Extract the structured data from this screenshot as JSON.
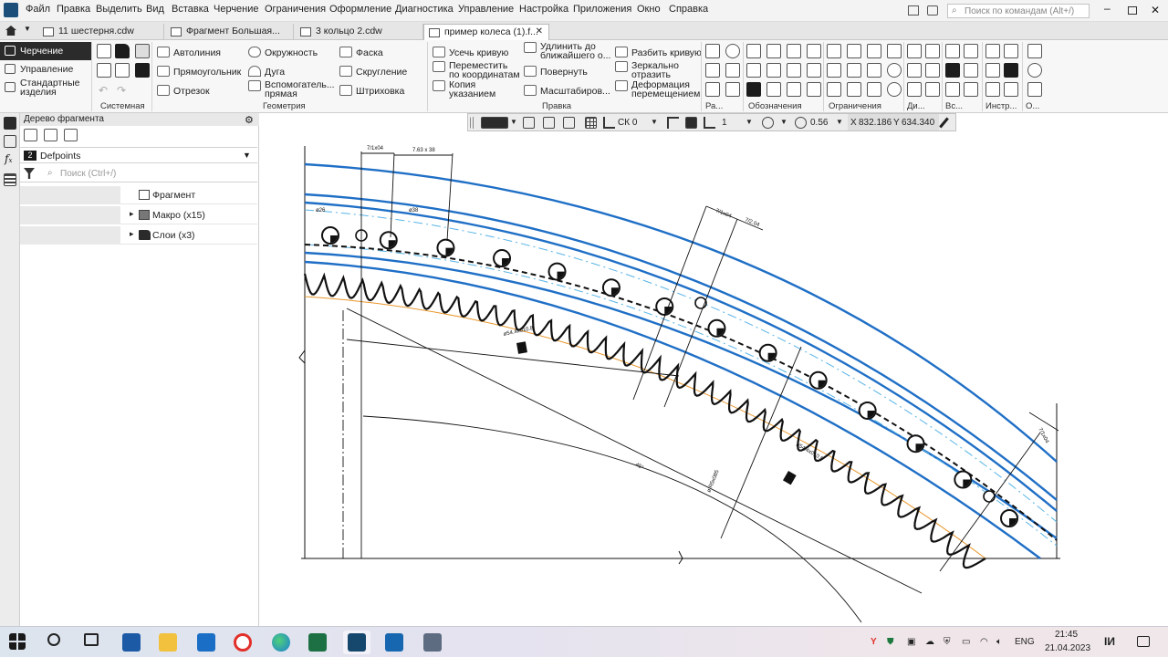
{
  "menubar": {
    "items": [
      "Файл",
      "Правка",
      "Выделить",
      "Вид",
      "Вставка",
      "Черчение",
      "Ограничения",
      "Оформление",
      "Диагностика",
      "Управление",
      "Настройка",
      "Приложения",
      "Окно",
      "Справка"
    ],
    "search_placeholder": "Поиск по командам (Alt+/)"
  },
  "tabs": [
    {
      "label": "11 шестерня.cdw"
    },
    {
      "label": "Фрагмент Большая..."
    },
    {
      "label": "3 кольцо 2.cdw"
    },
    {
      "label": "пример колеса (1).f...",
      "close": "✕"
    }
  ],
  "ribbon": {
    "nav": [
      "Черчение",
      "Управление",
      "Стандартные изделия"
    ],
    "groups": [
      "Системная",
      "Геометрия",
      "Правка",
      "Ра...",
      "Обозначения",
      "Ограничения",
      "Ди...",
      "Вс...",
      "Инстр...",
      "О..."
    ],
    "geometry": [
      [
        "Автолиния",
        "Прямоугольник",
        "Отрезок"
      ],
      [
        "Окружность",
        "Дуга",
        "Вспомогатель... прямая"
      ],
      [
        "Фаска",
        "Скругление",
        "Штриховка"
      ]
    ],
    "edit": [
      [
        "Усечь кривую",
        "Переместить по координатам",
        "Копия указанием"
      ],
      [
        "Удлинить до ближайшего о...",
        "Повернуть",
        "Масштабиров..."
      ],
      [
        "Разбить кривую",
        "Зеркально отразить",
        "Деформация перемещением"
      ]
    ]
  },
  "tree": {
    "title": "Дерево фрагмента",
    "layer_number": "2",
    "layer_name": "Defpoints",
    "search_placeholder": "Поиск (Ctrl+/)",
    "items": [
      {
        "label": "Фрагмент",
        "expander": ""
      },
      {
        "label": "Макро (x15)",
        "expander": "▸"
      },
      {
        "label": "Слои (x3)",
        "expander": "▸"
      }
    ]
  },
  "canvas_toolbar": {
    "cs": "СК 0",
    "step": "1",
    "zoom": "0.56",
    "x_label": "X",
    "x_value": "832.186",
    "y_label": "Y",
    "y_value": "634.340"
  },
  "drawing_labels": {
    "top_dims": [
      "7/1x04",
      "7.63 x 38"
    ],
    "left_dims": [
      "ø26",
      "ø38"
    ],
    "mid_dims": [
      "7/1x04",
      "7/2.04"
    ],
    "radius_labels": [
      "ø54.4x010.8",
      "ø54.4x010.8"
    ],
    "r_label": "ø R5x085",
    "angle": "45°",
    "right_dim": "7/1x04"
  },
  "taskbar": {
    "time": "21:45",
    "date": "21.04.2023",
    "lang": "ENG"
  },
  "colors": {
    "ribbon_active": "#2b2b2b",
    "drawing_blue": "#1f6fc6",
    "drawing_light": "#58b4e6",
    "drawing_orange": "#e8962a"
  }
}
